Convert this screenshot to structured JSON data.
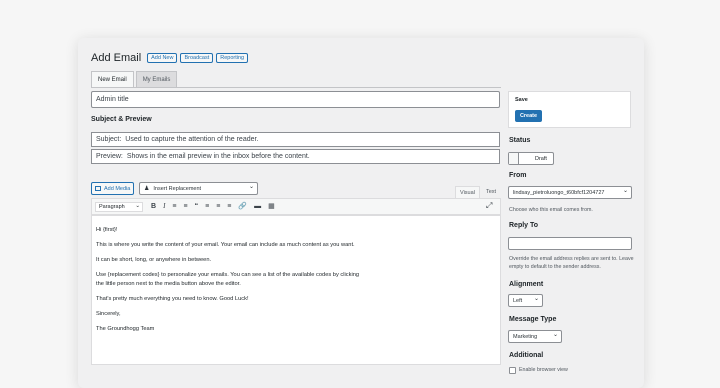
{
  "header": {
    "title": "Add Email",
    "buttons": [
      "Add New",
      "Broadcast",
      "Reporting"
    ]
  },
  "tabs": [
    {
      "label": "New Email",
      "active": true
    },
    {
      "label": "My Emails",
      "active": false
    }
  ],
  "admin_title": {
    "placeholder": "Admin title"
  },
  "subject_section": {
    "heading": "Subject & Preview",
    "subject_label": "Subject:",
    "subject_placeholder": "Used to capture the attention of the reader.",
    "preview_label": "Preview:",
    "preview_placeholder": "Shows in the email preview in the inbox before the content."
  },
  "editor": {
    "add_media": "Add Media",
    "replacement_select": "Insert Replacement",
    "tab_visual": "Visual",
    "tab_text": "Text",
    "format_select": "Paragraph",
    "toolbar_icons": [
      "bold-icon",
      "italic-icon",
      "bullet-list-icon",
      "numbered-list-icon",
      "blockquote-icon",
      "align-left-icon",
      "align-center-icon",
      "align-right-icon",
      "link-icon",
      "horizontal-rule-icon",
      "toolbar-toggle-icon"
    ],
    "paragraphs": [
      "Hi {first}!",
      "This is where you write the content of your email. Your email can include as much content as you want.",
      "It can be short, long, or anywhere in between.",
      "Use {replacement codes} to personalize your emails. You can see a list of the available codes by clicking the little person next to the media button above the editor.",
      "That's pretty much everything you need to know. Good Luck!",
      "Sincerely,",
      "The Groundhogg Team"
    ]
  },
  "sidebar": {
    "save_heading": "Save",
    "create_button": "Create",
    "status_label": "Status",
    "status_value": "Draft",
    "from_label": "From",
    "from_value": "lindsay_pietroluongo_t60bfcf1204727",
    "from_hint": "Choose who this email comes from.",
    "reply_label": "Reply To",
    "reply_hint": "Override the email address replies are sent to. Leave empty to default to the sender address.",
    "alignment_label": "Alignment",
    "alignment_value": "Left",
    "message_type_label": "Message Type",
    "message_type_value": "Marketing",
    "additional_label": "Additional",
    "browser_view_label": "Enable browser view"
  },
  "colors": {
    "accent": "#2271b1",
    "background": "#f0f0f1"
  }
}
